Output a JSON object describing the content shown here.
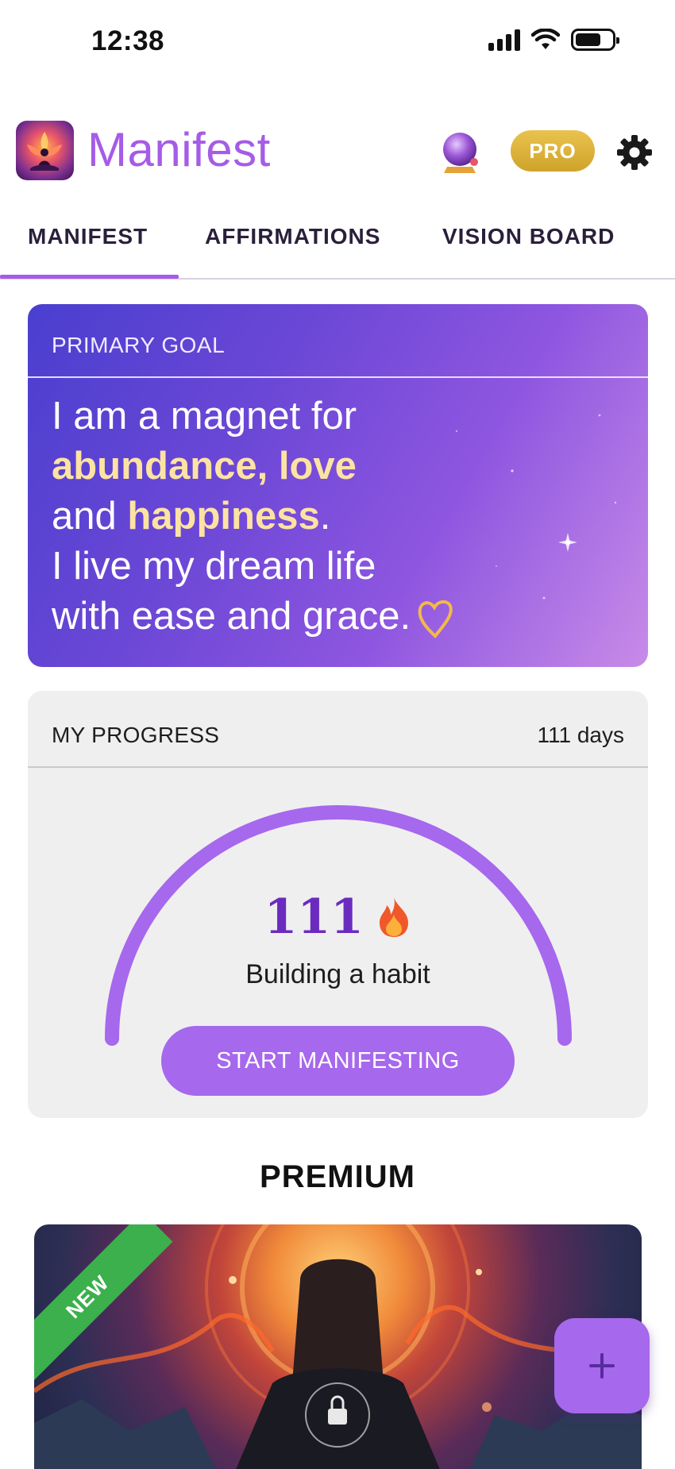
{
  "status_bar": {
    "time": "12:38"
  },
  "header": {
    "title": "Manifest",
    "logo_icon": "lotus-meditation-logo",
    "pro_label": "PRO",
    "accent_color": "#a55ce6"
  },
  "tabs": [
    {
      "label": "MANIFEST",
      "active": true
    },
    {
      "label": "AFFIRMATIONS",
      "active": false
    },
    {
      "label": "VISION BOARD",
      "active": false
    }
  ],
  "goal_card": {
    "label": "PRIMARY GOAL",
    "line1": "I am a magnet for",
    "highlight1": "abundance, love",
    "line3_prefix": "and ",
    "highlight2": "happiness",
    "line3_suffix": ".",
    "line4": "I live my dream life",
    "line5": "with ease and grace."
  },
  "progress_card": {
    "label": "MY PROGRESS",
    "days": "111 days",
    "streak": "111",
    "caption": "Building a habit",
    "button_label": "START MANIFESTING"
  },
  "premium": {
    "title": "PREMIUM",
    "ribbon": "NEW"
  },
  "fab": {
    "icon": "plus-icon"
  }
}
